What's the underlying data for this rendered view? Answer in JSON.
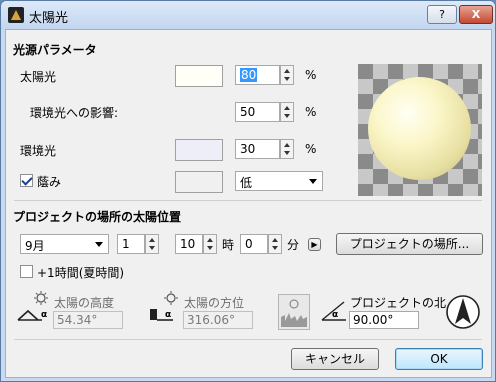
{
  "window": {
    "title": "太陽光",
    "help_label": "?",
    "close_label": "X"
  },
  "light_params": {
    "header": "光源パラメータ",
    "sun": {
      "label": "太陽光",
      "value": "80",
      "unit": "%",
      "swatch_color": "#fffff8"
    },
    "ambient_effect": {
      "label": "環境光への影響:",
      "value": "50",
      "unit": "%"
    },
    "ambient": {
      "label": "環境光",
      "value": "30",
      "unit": "%",
      "swatch_color": "#eeeef8"
    },
    "shadow": {
      "label": "蔭み",
      "checked": true,
      "swatch_color": "#f0f0f0",
      "level": "低"
    }
  },
  "sun_position": {
    "header": "プロジェクトの場所の太陽位置",
    "month": "9月",
    "day": "1",
    "hour": "10",
    "hour_label": "時",
    "minute": "0",
    "minute_label": "分",
    "project_location_button": "プロジェクトの場所...",
    "dst": {
      "label": "+1時間(夏時間)",
      "checked": false
    },
    "altitude": {
      "label": "太陽の高度",
      "value": "54.34°",
      "icon": "sun-altitude-icon"
    },
    "azimuth": {
      "label": "太陽の方位",
      "value": "316.06°",
      "icon": "sun-azimuth-icon"
    },
    "project_north": {
      "label": "プロジェクトの北",
      "value": "90.00°",
      "icon": "project-north-icon"
    }
  },
  "buttons": {
    "cancel": "キャンセル",
    "ok": "OK"
  }
}
